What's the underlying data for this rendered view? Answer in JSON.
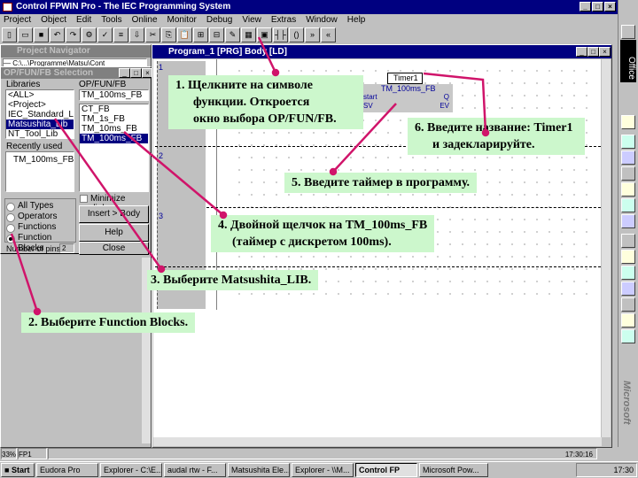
{
  "app": {
    "title": "Control FPWIN Pro - The IEC Programming System"
  },
  "menu": [
    "Project",
    "Object",
    "Edit",
    "Tools",
    "Online",
    "Monitor",
    "Debug",
    "View",
    "Extras",
    "Window",
    "Help"
  ],
  "toolbar": {
    "icons": [
      "new",
      "open",
      "save",
      "undo",
      "redo",
      "compile",
      "check",
      "build",
      "download",
      "cut",
      "copy",
      "paste",
      "insert-line",
      "delete-line",
      "pencil",
      "network",
      "function-block",
      "contact",
      "coil",
      "jump",
      "return"
    ]
  },
  "navigator": {
    "title": "Project Navigator",
    "path": "— C:\\...\\Programme\\Matsu\\Cont"
  },
  "selection": {
    "title": "OP/FUN/FB Selection",
    "libraries_label": "Libraries",
    "libraries": [
      "<ALL>",
      "<Project>",
      "IEC_Standard_Lib",
      "Matsushita_Lib",
      "NT_Tool_Lib"
    ],
    "selected_library": "Matsushita_Lib",
    "opfunfb_label": "OP/FUN/FB",
    "opfunfb_value": "TM_100ms_FB",
    "items": [
      "CT_FB",
      "TM_1s_FB",
      "TM_10ms_FB",
      "TM_100ms_FB"
    ],
    "selected_item": "TM_100ms_FB",
    "recent_label": "Recently used",
    "recent": [
      "TM_100ms_FB"
    ],
    "types_label": "Types",
    "types": [
      "All Types",
      "Operators",
      "Functions",
      "Function Blocks"
    ],
    "selected_type": "Function Blocks",
    "minimize_label": "Minimize dialog",
    "insert_label": "Insert > Body",
    "help_label": "Help",
    "close_label": "Close",
    "num_inputs_label": "Number of pins",
    "num_inputs_value": "2"
  },
  "program": {
    "title": "Program_1 [PRG] Body [LD]",
    "rungs": [
      "1",
      "2",
      "3"
    ],
    "fb": {
      "instance": "Timer1",
      "type": "TM_100ms_FB",
      "in1": "start",
      "in2": "SV",
      "out1": "Q",
      "out2": "EV"
    }
  },
  "office_bar": {
    "label": "Office"
  },
  "status": {
    "zoom": "33%",
    "mode": "FP1 C.7k",
    "time": "17:30:16"
  },
  "taskbar": {
    "start": "Start",
    "items": [
      "Eudora Pro",
      "Explorer - C:\\E...",
      "audal rtw - F...",
      "Matsushita Ele...",
      "Explorer - \\\\M...",
      "Control FP",
      "Microsoft Pow..."
    ],
    "active": "Control FP",
    "clock": "17:30"
  },
  "watermark": "Microsoft",
  "callouts": {
    "c1": [
      "1. Щелкните на символе",
      "функции. Откроется",
      "окно выбора OP/FUN/FB."
    ],
    "c2": "2. Выберите Function Blocks.",
    "c3": "3. Выберите Matsushita_LIB.",
    "c4": [
      "4. Двойной щелчок на TM_100ms_FB",
      "(таймер с дискретом 100ms)."
    ],
    "c5": "5. Введите таймер в программу.",
    "c6": [
      "6. Введите название: Timer1",
      "и задекларируйте."
    ]
  },
  "colors": {
    "arrow": "#d0146a",
    "callout_bg": "#ccf7cc",
    "titlebar": "#000080"
  }
}
